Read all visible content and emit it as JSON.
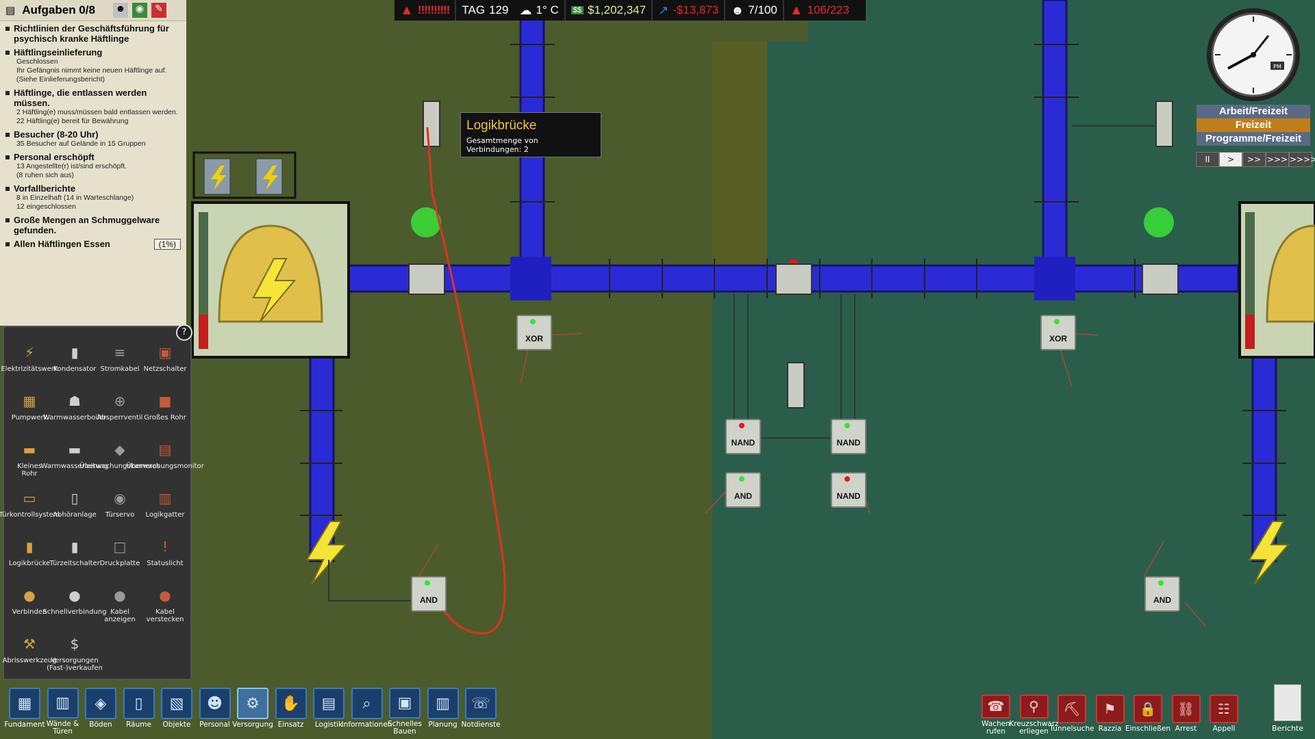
{
  "hud": {
    "danger_level": "!!!!!!!!!!",
    "day_label": "TAG",
    "day_value": "129",
    "temperature": "1° C",
    "money": "$1,202,347",
    "balance": "-$13,873",
    "staff_count": "7/100",
    "alert_count": "106/223"
  },
  "tasks": {
    "header": "Aufgaben 0/8",
    "items": [
      {
        "title": "Richtlinien der Geschäftsführung für psychisch kranke Häftlinge",
        "lines": []
      },
      {
        "title": "Häftlingseinlieferung",
        "lines": [
          "Geschlossen",
          "Ihr Gefängnis nimmt keine neuen Häftlinge auf.",
          "(Siehe Einlieferungsbericht)"
        ]
      },
      {
        "title": "Häftlinge, die entlassen werden müssen.",
        "lines": [
          "2 Häftling(e) muss/müssen bald entlassen werden.",
          "22 Häftling(e) bereit für Bewährung"
        ]
      },
      {
        "title": "Besucher (8-20 Uhr)",
        "lines": [
          "35 Besucher auf Gelände in 15 Gruppen"
        ]
      },
      {
        "title": "Personal erschöpft",
        "lines": [
          "13 Angestellte(r) ist/sind erschöpft.",
          "(8 ruhen sich aus)"
        ]
      },
      {
        "title": "Vorfallberichte",
        "lines": [
          "8 in Einzelhaft (14 in Warteschlange)",
          "12 eingeschlossen"
        ]
      },
      {
        "title": "Große Mengen an Schmuggelware gefunden.",
        "lines": []
      },
      {
        "title": "Allen Häftlingen Essen",
        "lines": []
      }
    ],
    "last_badge": "(1%)"
  },
  "build_menu": {
    "items": [
      {
        "label": "Elektrizitätswerk",
        "icon": "power-plant-icon",
        "glyph": "⚡"
      },
      {
        "label": "Kondensator",
        "icon": "capacitor-icon",
        "glyph": "▮"
      },
      {
        "label": "Stromkabel",
        "icon": "cable-icon",
        "glyph": "≡"
      },
      {
        "label": "Netzschalter",
        "icon": "switch-icon",
        "glyph": "▣"
      },
      {
        "label": "Pumpwerk",
        "icon": "pump-icon",
        "glyph": "▦"
      },
      {
        "label": "Warmwasserboiler",
        "icon": "boiler-icon",
        "glyph": "☗"
      },
      {
        "label": "Absperrventil",
        "icon": "valve-icon",
        "glyph": "⊕"
      },
      {
        "label": "Großes Rohr",
        "icon": "large-pipe-icon",
        "glyph": "■"
      },
      {
        "label": "Kleines Rohr",
        "icon": "small-pipe-icon",
        "glyph": "▬"
      },
      {
        "label": "Warmwasserleitung",
        "icon": "hot-pipe-icon",
        "glyph": "▬"
      },
      {
        "label": "Überwachungskameras",
        "icon": "camera-icon",
        "glyph": "◆"
      },
      {
        "label": "Überwachungsmonitor",
        "icon": "monitor-icon",
        "glyph": "▤"
      },
      {
        "label": "Türkontrollsystem",
        "icon": "door-control-icon",
        "glyph": "▭"
      },
      {
        "label": "Abhöranlage",
        "icon": "listening-icon",
        "glyph": "▯"
      },
      {
        "label": "Türservo",
        "icon": "door-servo-icon",
        "glyph": "◉"
      },
      {
        "label": "Logikgatter",
        "icon": "logic-gate-icon",
        "glyph": "▥"
      },
      {
        "label": "Logikbrücke",
        "icon": "logic-bridge-icon",
        "glyph": "▮"
      },
      {
        "label": "Türzeitschalter",
        "icon": "door-timer-icon",
        "glyph": "▮"
      },
      {
        "label": "Druckplatte",
        "icon": "pressure-plate-icon",
        "glyph": "□"
      },
      {
        "label": "Statuslicht",
        "icon": "status-light-icon",
        "glyph": "!"
      },
      {
        "label": "Verbinden",
        "icon": "connect-icon",
        "glyph": "●"
      },
      {
        "label": "Schnellverbindung",
        "icon": "quick-connect-icon",
        "glyph": "●"
      },
      {
        "label": "Kabel anzeigen",
        "icon": "show-cable-icon",
        "glyph": "●"
      },
      {
        "label": "Kabel verstecken",
        "icon": "hide-cable-icon",
        "glyph": "●"
      },
      {
        "label": "Abrisswerkzeug",
        "icon": "demolish-icon",
        "glyph": "⚒"
      },
      {
        "label": "Versorgungen (Fast-)verkaufen",
        "icon": "sell-icon",
        "glyph": "$"
      }
    ]
  },
  "toolbar": {
    "items": [
      {
        "label": "Fundament",
        "icon": "foundation-icon",
        "glyph": "▦"
      },
      {
        "label": "Wände & Türen",
        "icon": "walls-icon",
        "glyph": "▥"
      },
      {
        "label": "Böden",
        "icon": "floors-icon",
        "glyph": "◈"
      },
      {
        "label": "Räume",
        "icon": "rooms-icon",
        "glyph": "▯"
      },
      {
        "label": "Objekte",
        "icon": "objects-icon",
        "glyph": "▧"
      },
      {
        "label": "Personal",
        "icon": "staff-icon",
        "glyph": "☻"
      },
      {
        "label": "Versorgung",
        "icon": "utilities-icon",
        "glyph": "⚙"
      },
      {
        "label": "Einsatz",
        "icon": "deploy-icon",
        "glyph": "✋"
      },
      {
        "label": "Logistik",
        "icon": "logistics-icon",
        "glyph": "▤"
      },
      {
        "label": "Informationen",
        "icon": "info-icon",
        "glyph": "⌕"
      },
      {
        "label": "Schnelles Bauen",
        "icon": "quick-build-icon",
        "glyph": "▣"
      },
      {
        "label": "Planung",
        "icon": "planning-icon",
        "glyph": "▥"
      },
      {
        "label": "Notdienste",
        "icon": "emergency-icon",
        "glyph": "☏"
      }
    ],
    "right_items": [
      {
        "label": "Wachen rufen",
        "icon": "call-guards-icon",
        "glyph": "☎"
      },
      {
        "label": "Kreuzschwarz erliegen",
        "icon": "search-cell-icon",
        "glyph": "⚲"
      },
      {
        "label": "Tunnelsuche",
        "icon": "tunnel-search-icon",
        "glyph": "⛏"
      },
      {
        "label": "Razzia",
        "icon": "raid-icon",
        "glyph": "⚑"
      },
      {
        "label": "Einschließen",
        "icon": "lockdown-icon",
        "glyph": "🔒"
      },
      {
        "label": "Arrest",
        "icon": "arrest-icon",
        "glyph": "⛓"
      },
      {
        "label": "Appell",
        "icon": "rollcall-icon",
        "glyph": "☷"
      }
    ],
    "reports_label": "Berichte"
  },
  "tooltip": {
    "title": "Logikbrücke",
    "text": "Gesamtmenge von Verbindungen: 2"
  },
  "gates": {
    "xor": "XOR",
    "nand": "NAND",
    "and": "AND"
  },
  "regime": {
    "lines": [
      "Arbeit/Freizeit",
      "Freizeit",
      "Programme/Freizeit"
    ]
  },
  "speed": {
    "buttons": [
      "II",
      ">",
      ">>",
      ">>>",
      ">>>>"
    ]
  },
  "clock": {
    "ampm": "PM"
  },
  "colors": {
    "pipe": "#2d2dcf",
    "grass_left": "#4a5a2a",
    "grass_right": "#285c4a",
    "panel": "#e6e1cc",
    "danger": "#e42a2a"
  }
}
